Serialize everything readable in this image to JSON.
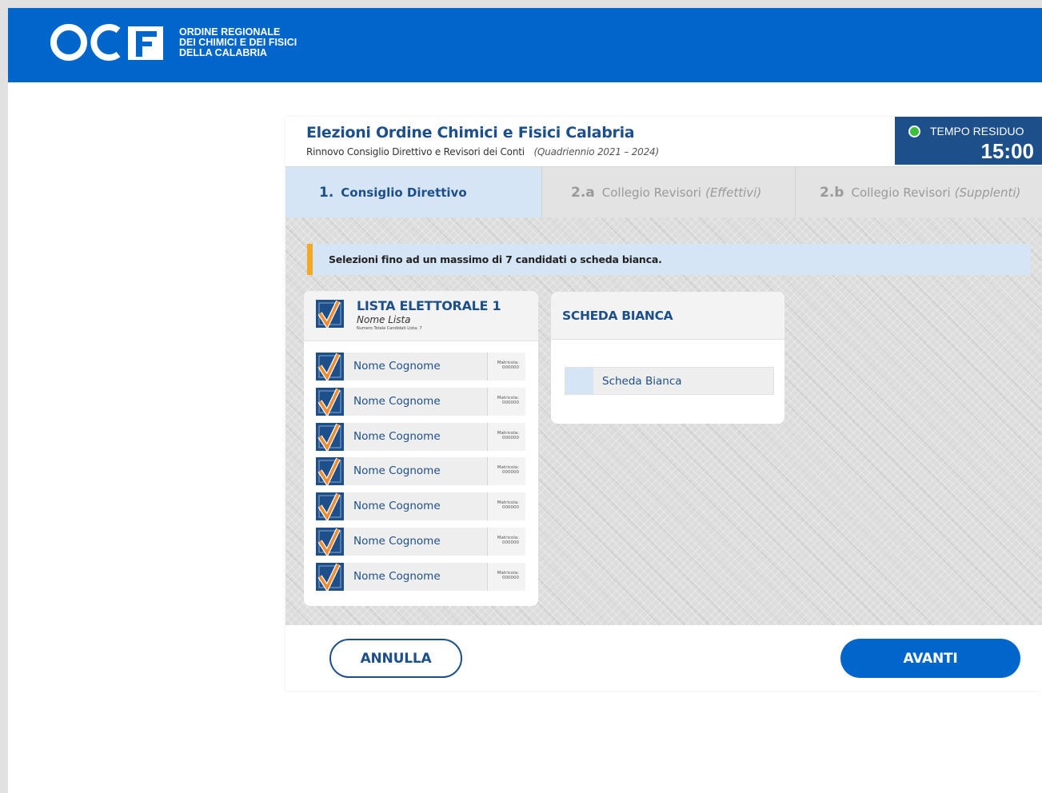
{
  "header": {
    "logo_letters": "OCF",
    "org_line1": "ORDINE REGIONALE",
    "org_line2": "DEI CHIMICI E DEI FISICI",
    "org_line3": "DELLA CALABRIA",
    "brand_color": "#0066cc"
  },
  "election": {
    "title": "Elezioni Ordine Chimici e Fisici Calabria",
    "subtitle": "Rinnovo Consiglio Direttivo e Revisori dei Conti",
    "period": "(Quadriennio 2021 – 2024)"
  },
  "timer": {
    "label": "TEMPO RESIDUO",
    "value": "15:00",
    "status_color": "#3bc03b"
  },
  "tabs": [
    {
      "num": "1.",
      "label": "Consiglio Direttivo",
      "italic": "",
      "active": true
    },
    {
      "num": "2.a",
      "label": "Collegio Revisori",
      "italic": "(Effettivi)",
      "active": false
    },
    {
      "num": "2.b",
      "label": "Collegio Revisori",
      "italic": "(Supplenti)",
      "active": false
    }
  ],
  "notice": "Selezioni fino ad un massimo di 7 candidati o scheda bianca.",
  "list": {
    "title": "LISTA ELETTORALE 1",
    "name": "Nome Lista",
    "count_text": "Numero Totale Candidati Lista: 7",
    "candidates": [
      {
        "name": "Nome Cognome",
        "mat_label": "Matricola:",
        "mat_value": "000000"
      },
      {
        "name": "Nome Cognome",
        "mat_label": "Matricola:",
        "mat_value": "000000"
      },
      {
        "name": "Nome Cognome",
        "mat_label": "Matricola:",
        "mat_value": "000000"
      },
      {
        "name": "Nome Cognome",
        "mat_label": "Matricola:",
        "mat_value": "000000"
      },
      {
        "name": "Nome Cognome",
        "mat_label": "Matricola:",
        "mat_value": "000000"
      },
      {
        "name": "Nome Cognome",
        "mat_label": "Matricola:",
        "mat_value": "000000"
      },
      {
        "name": "Nome Cognome",
        "mat_label": "Matricola:",
        "mat_value": "000000"
      }
    ]
  },
  "blank": {
    "title": "SCHEDA BIANCA",
    "option_label": "Scheda Bianca"
  },
  "footer": {
    "cancel_label": "ANNULLA",
    "next_label": "AVANTI"
  },
  "colors": {
    "accent_dark": "#1d4f8a",
    "check_orange": "#f28a2e",
    "notice_bar": "#f4a925"
  }
}
